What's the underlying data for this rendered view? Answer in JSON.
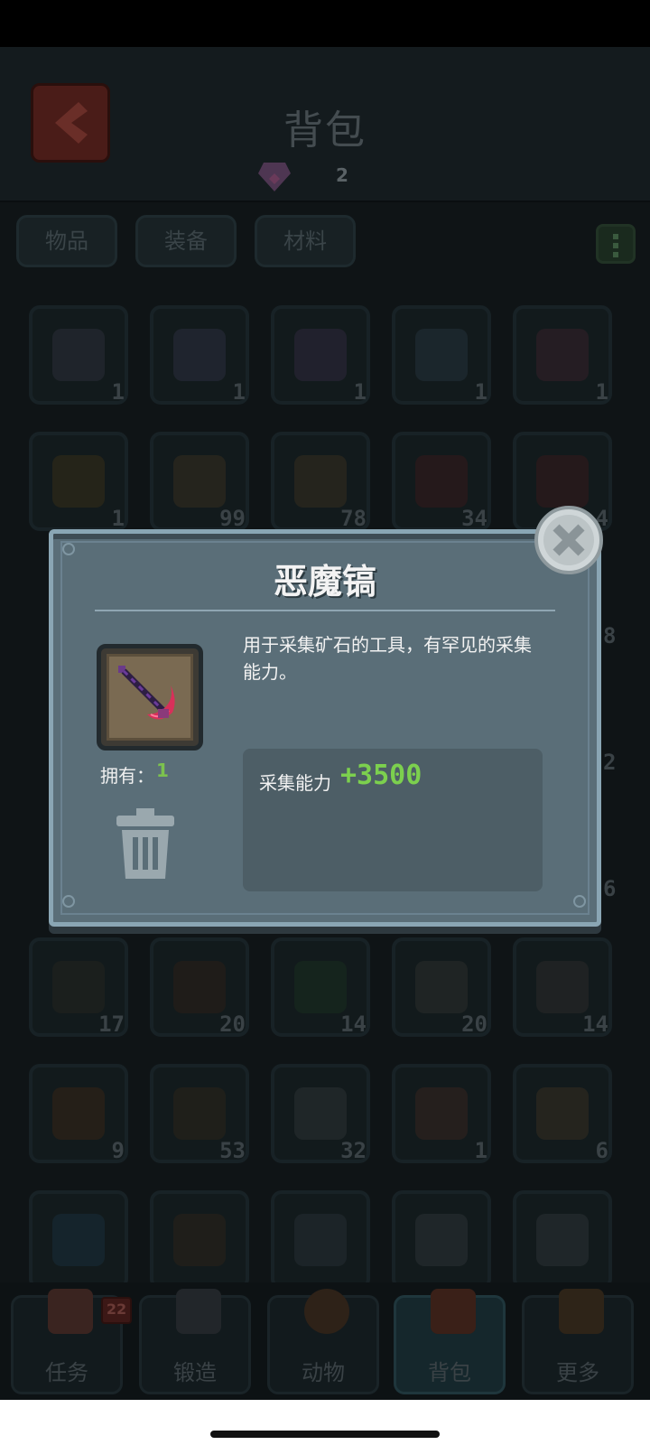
{
  "header": {
    "title": "背包",
    "gem_count": "2"
  },
  "tabs": [
    {
      "label": "物品"
    },
    {
      "label": "装备"
    },
    {
      "label": "材料"
    }
  ],
  "grid": {
    "items": [
      {
        "count": "1",
        "color": "#3a3a48"
      },
      {
        "count": "1",
        "color": "#3a3a50"
      },
      {
        "count": "1",
        "color": "#40304e"
      },
      {
        "count": "1",
        "color": "#2e3e4a"
      },
      {
        "count": "1",
        "color": "#4a2632"
      },
      {
        "count": "1",
        "color": "#4a3a14"
      },
      {
        "count": "99",
        "color": "#4a3a20"
      },
      {
        "count": "78",
        "color": "#4a3a20"
      },
      {
        "count": "34",
        "color": "#4a1a1a"
      },
      {
        "count": "4",
        "color": "#4a1a1a"
      },
      {
        "count": "17",
        "color": "#2e2a20"
      },
      {
        "count": "20",
        "color": "#3a2214"
      },
      {
        "count": "14",
        "color": "#1e3a20"
      },
      {
        "count": "20",
        "color": "#3a3a34"
      },
      {
        "count": "14",
        "color": "#3a3430"
      },
      {
        "count": "9",
        "color": "#4a2a10"
      },
      {
        "count": "53",
        "color": "#3a2a18"
      },
      {
        "count": "32",
        "color": "#3a3e40"
      },
      {
        "count": "1",
        "color": "#4a2a20"
      },
      {
        "count": "6",
        "color": "#4a3a22"
      },
      {
        "count": "",
        "color": "#1e3a4a"
      },
      {
        "count": "",
        "color": "#3a2818"
      },
      {
        "count": "",
        "color": "#323a40"
      },
      {
        "count": "",
        "color": "#3a3e42"
      },
      {
        "count": "",
        "color": "#3a3e42"
      }
    ],
    "side_counts": [
      "8",
      "2",
      "6"
    ]
  },
  "dialog": {
    "title": "恶魔镐",
    "description": "用于采集矿石的工具，有罕见的采集能力。",
    "own_label": "拥有：",
    "own_value": "1",
    "stat_label": "采集能力",
    "stat_value": "+3500"
  },
  "bottom_nav": {
    "items": [
      {
        "label": "任务"
      },
      {
        "label": "锻造"
      },
      {
        "label": "动物"
      },
      {
        "label": "背包"
      },
      {
        "label": "更多"
      }
    ],
    "badge": "22"
  },
  "colors": {
    "stat_green": "#7cd04e",
    "dialog_bg": "#5a6e78",
    "dialog_border": "#8aa6b4"
  }
}
